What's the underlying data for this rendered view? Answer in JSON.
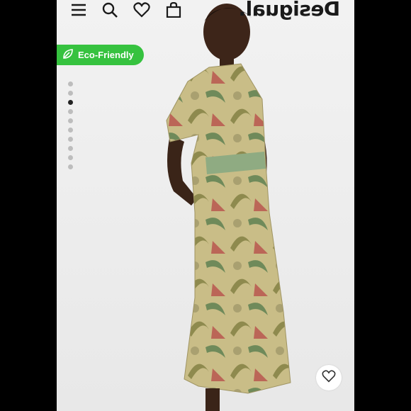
{
  "header": {
    "brand_logo": "Desigual.",
    "icons": [
      "menu-icon",
      "search-icon",
      "heart-icon",
      "bag-icon"
    ]
  },
  "badge": {
    "label": "Eco-Friendly",
    "color": "#36c23f",
    "icon": "leaf-icon"
  },
  "gallery": {
    "image_count": 10,
    "active_index": 2
  },
  "colors": {
    "accent": "#36c23f",
    "dot_active": "#222222",
    "dot_inactive": "#bdbdbd"
  }
}
